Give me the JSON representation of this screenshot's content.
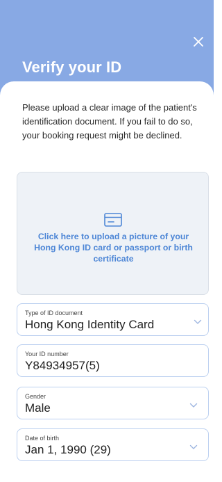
{
  "header": {
    "title": "Verify your ID",
    "background_color": "#88a9e4",
    "close_icon": "close-icon"
  },
  "intro_text": "Please upload a clear image of the patient's identification document. If you fail to do so, your booking request might be declined.",
  "upload": {
    "icon": "id-card-icon",
    "text": "Click here to upload a picture of your Hong Kong ID card or passport or birth certificate",
    "accent_color": "#4d86d6"
  },
  "fields": {
    "id_type": {
      "label": "Type of ID document",
      "value": "Hong Kong Identity Card"
    },
    "id_number": {
      "label": "Your ID number",
      "value": "Y84934957(5)"
    },
    "gender": {
      "label": "Gender",
      "value": "Male"
    },
    "dob": {
      "label": "Date of birth",
      "value": "Jan 1, 1990 (29)"
    }
  }
}
